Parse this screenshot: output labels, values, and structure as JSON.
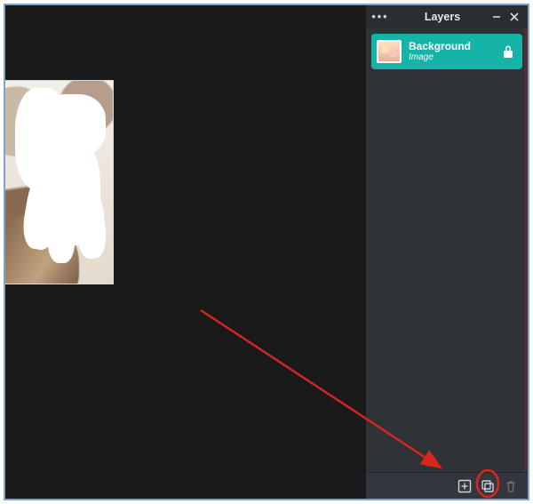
{
  "panel": {
    "title": "Layers",
    "menu_icon": "more-icon",
    "minimize_icon": "minus-icon",
    "close_icon": "x-icon"
  },
  "layers": [
    {
      "name": "Background",
      "type": "Image",
      "locked": true,
      "selected": true
    }
  ],
  "footer": {
    "add_icon": "add-layer-icon",
    "duplicate_icon": "duplicate-layer-icon",
    "delete_icon": "delete-layer-icon"
  },
  "colors": {
    "panel_bg": "#2f3338",
    "selected_layer": "#16b3a9",
    "canvas_bg": "#1a1a1a",
    "frame_border": "#7ea3c9",
    "annotation": "#d9261c"
  }
}
